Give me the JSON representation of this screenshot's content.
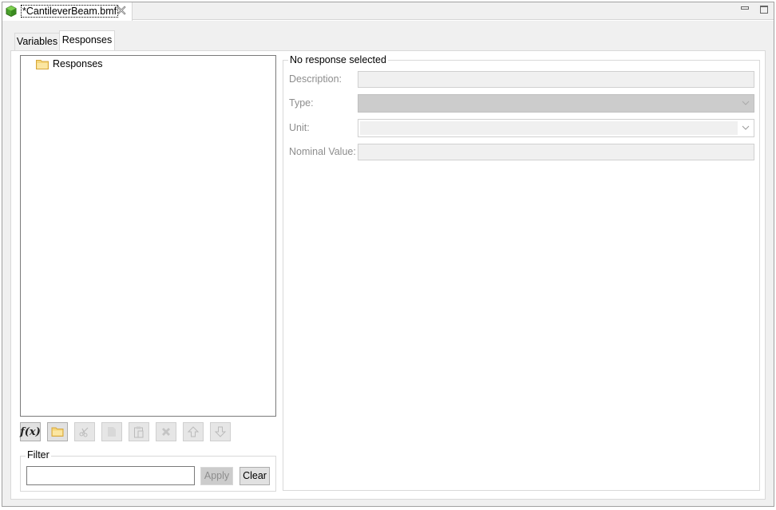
{
  "editor": {
    "tab_title": "*CantileverBeam.bmf",
    "tab_icon": "green-cube-icon",
    "close_icon": "close-icon",
    "window_controls": [
      "minimize-icon",
      "maximize-icon"
    ]
  },
  "subtabs": [
    {
      "label": "Variables",
      "selected": false
    },
    {
      "label": "Responses",
      "selected": true
    }
  ],
  "tree": {
    "items": [
      {
        "label": "Responses",
        "icon": "folder-icon"
      }
    ]
  },
  "toolbar": {
    "buttons": [
      {
        "name": "add-function",
        "icon": "function-icon",
        "text": "f(x)",
        "enabled": true
      },
      {
        "name": "add-folder",
        "icon": "folder-icon",
        "enabled": true
      },
      {
        "name": "cut",
        "icon": "scissors-icon",
        "enabled": false
      },
      {
        "name": "copy",
        "icon": "copy-icon",
        "enabled": false
      },
      {
        "name": "paste",
        "icon": "paste-icon",
        "enabled": false
      },
      {
        "name": "delete",
        "icon": "delete-icon",
        "enabled": false
      },
      {
        "name": "move-up",
        "icon": "arrow-up-icon",
        "enabled": false
      },
      {
        "name": "move-down",
        "icon": "arrow-down-icon",
        "enabled": false
      }
    ]
  },
  "filter": {
    "legend": "Filter",
    "value": "",
    "apply_label": "Apply",
    "clear_label": "Clear"
  },
  "details": {
    "legend": "No response selected",
    "fields": {
      "description": {
        "label": "Description:",
        "value": ""
      },
      "type": {
        "label": "Type:",
        "value": ""
      },
      "unit": {
        "label": "Unit:",
        "value": ""
      },
      "nominal_value": {
        "label": "Nominal Value:",
        "value": ""
      }
    }
  }
}
